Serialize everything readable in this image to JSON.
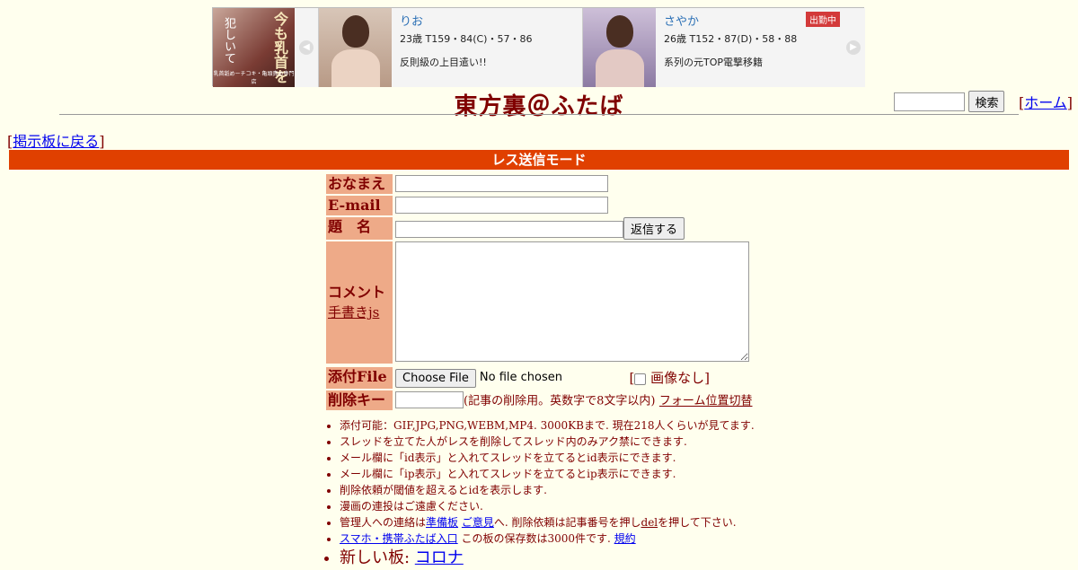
{
  "banner": {
    "ad": {
      "line1": "今も",
      "line1b": "乳首を",
      "line2": "犯しいて",
      "footer": "乳首舐めーチコキ・亀頭責め専門店"
    },
    "cards": [
      {
        "name": "りお",
        "stats": "23歳 T159・84(C)・57・86",
        "desc": "反則級の上目遣い!!",
        "badge": ""
      },
      {
        "name": "さやか",
        "stats": "26歳 T152・87(D)・58・88",
        "desc": "系列の元TOP電撃移籍",
        "badge": "出勤中"
      }
    ],
    "prev_glyph": "◀",
    "next_glyph": "▶"
  },
  "header": {
    "title": "東方裏＠ふたば",
    "search_button": "検索",
    "search_placeholder": "",
    "home_open": "[",
    "home_label": "ホーム",
    "home_close": "]"
  },
  "nav": {
    "back_open": "[",
    "back_label": "掲示板に戻る",
    "back_close": "]"
  },
  "mode_bar": "レス送信モード",
  "form": {
    "name_label": "おなまえ",
    "email_label": "E-mail",
    "subject_label": "題　名",
    "submit_label": "返信する",
    "comment_label": "コメント",
    "tegaki_label": "手書きjs",
    "file_label": "添付File",
    "file_button": "Choose File",
    "file_status": "No file chosen",
    "noimg_open": "[",
    "noimg_label": "画像なし",
    "noimg_close": "]",
    "delkey_label": "削除キー",
    "delkey_note": "(記事の削除用。英数字で8文字以内)",
    "form_toggle": "フォーム位置切替"
  },
  "notes": {
    "n1": "添付可能：GIF,JPG,PNG,WEBM,MP4. 3000KBまで. 現在218人くらいが見てます.",
    "n2": "スレッドを立てた人がレスを削除してスレッド内のみアク禁にできます.",
    "n3": "メール欄に「id表示」と入れてスレッドを立てるとid表示にできます.",
    "n4": "メール欄に「ip表示」と入れてスレッドを立てるとip表示にできます.",
    "n5": "削除依頼が閾値を超えるとidを表示します.",
    "n6": "漫画の連投はご遠慮ください.",
    "n7_pre": "管理人への連絡は",
    "n7_link1": "準備板",
    "n7_link2": "ご意見",
    "n7_mid": "へ. 削除依頼は記事番号を押し",
    "n7_del": "del",
    "n7_post": "を押して下さい.",
    "n8_link": "スマホ・携帯ふたば入口",
    "n8_mid": " この板の保存数は3000件です. ",
    "n8_rules": "規約",
    "n9_pre": "新しい板: ",
    "n9_link": "コロナ"
  },
  "colors": {
    "background": "#FFFFEE",
    "text": "#800000",
    "label_bg": "#EEAA88",
    "mode_bar": "#E04000",
    "link": "#0000EE"
  }
}
